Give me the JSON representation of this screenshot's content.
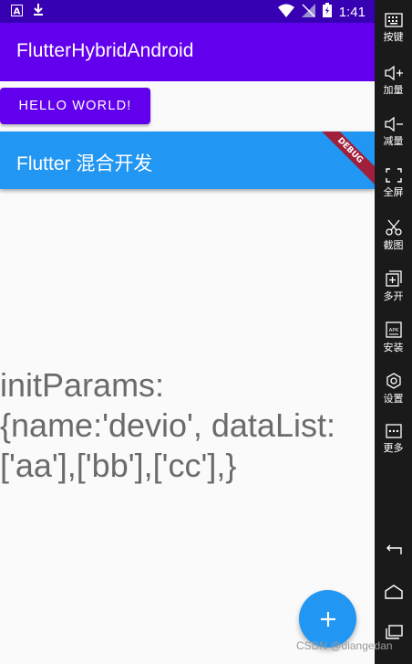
{
  "status_bar": {
    "time": "1:41"
  },
  "app_bar": {
    "title": "FlutterHybridAndroid"
  },
  "hello_button": {
    "label": "HELLO WORLD!"
  },
  "flutter_bar": {
    "title": "Flutter 混合开发",
    "debug_banner": "DEBUG"
  },
  "content": {
    "line1": "initParams:",
    "line2": "{name:'devio', dataList:",
    "line3": "['aa'],['bb'],['cc'],}"
  },
  "fab": {
    "icon": "plus-icon"
  },
  "side_toolbar": {
    "items": [
      {
        "label": "按键",
        "icon": "keyboard-icon"
      },
      {
        "label": "加量",
        "icon": "volume-up-icon"
      },
      {
        "label": "减量",
        "icon": "volume-down-icon"
      },
      {
        "label": "全屏",
        "icon": "fullscreen-icon"
      },
      {
        "label": "截图",
        "icon": "scissors-icon"
      },
      {
        "label": "多开",
        "icon": "multi-open-icon"
      },
      {
        "label": "安装",
        "icon": "apk-install-icon"
      },
      {
        "label": "设置",
        "icon": "settings-icon"
      },
      {
        "label": "更多",
        "icon": "more-icon"
      }
    ]
  },
  "watermark": "CSDN @diangedan",
  "colors": {
    "status_bar": "#3700b3",
    "primary": "#6200ee",
    "flutter_blue": "#2196f3",
    "debug": "#a01f3b",
    "toolbar": "#1a1a1a"
  }
}
